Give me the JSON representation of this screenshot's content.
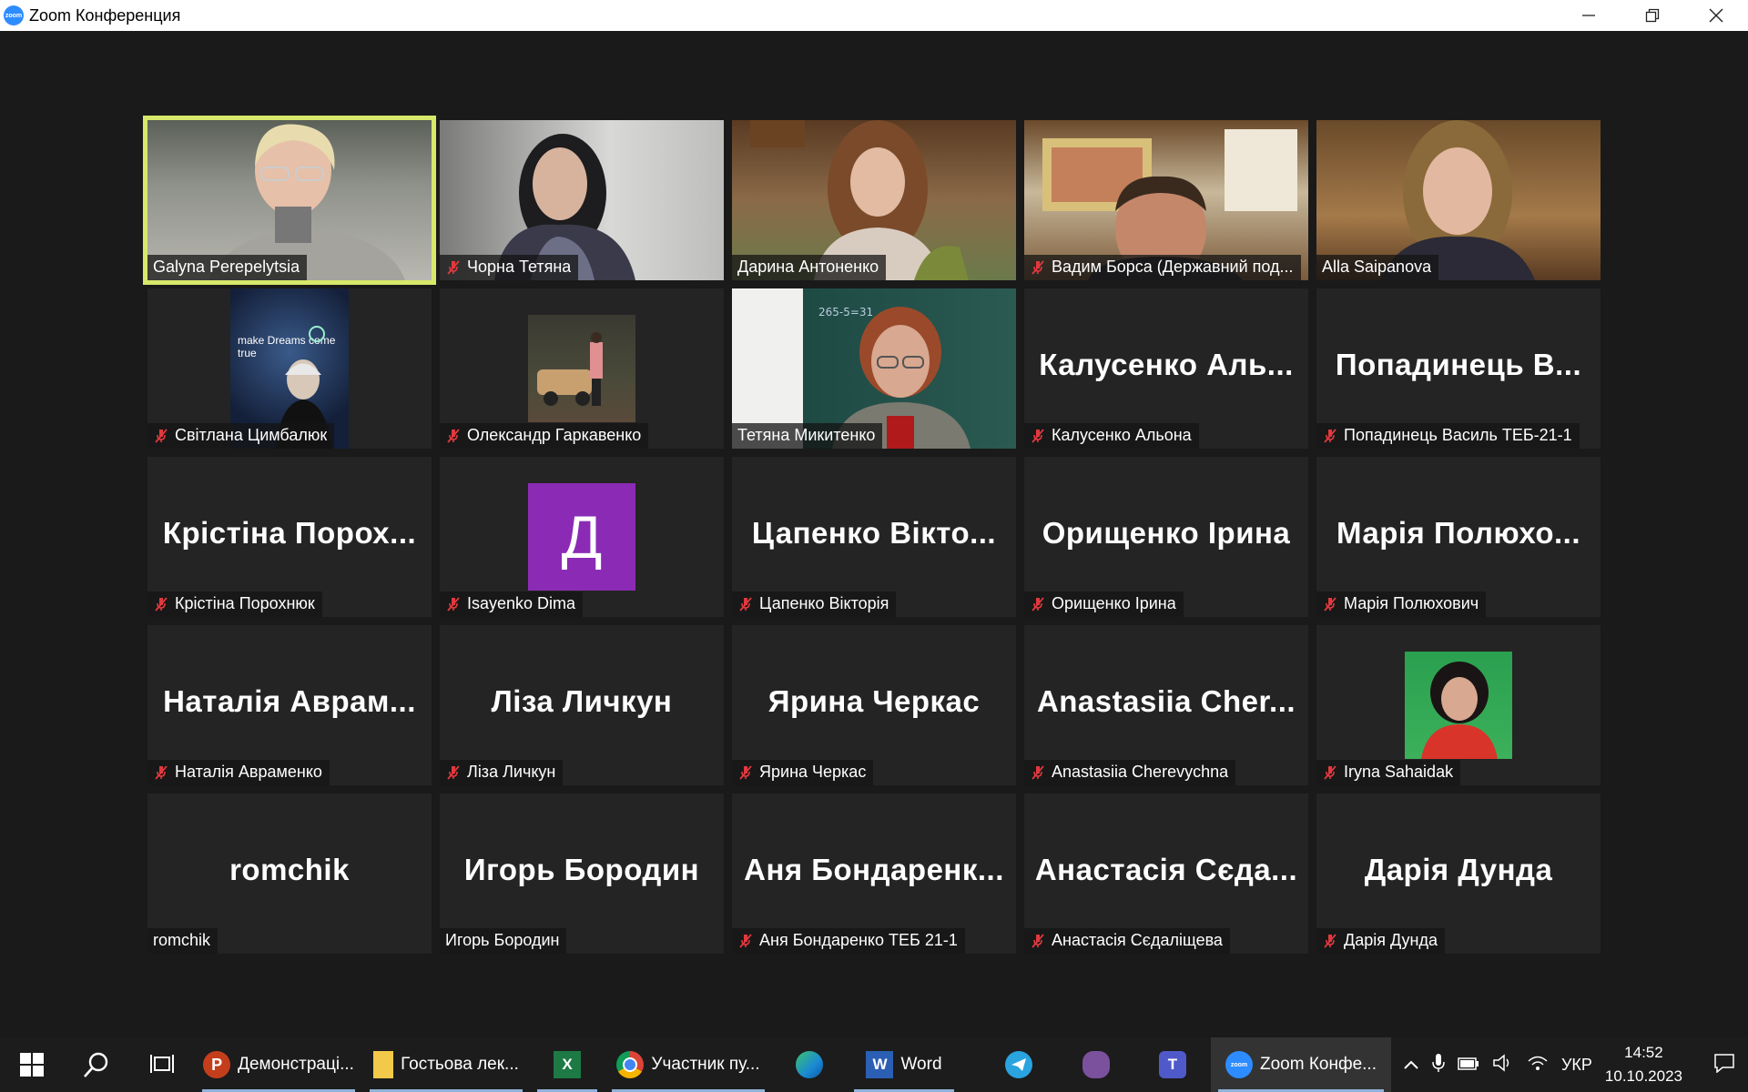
{
  "window": {
    "title": "Zoom Конференция",
    "logo_text": "zoom",
    "minimize": "—",
    "restore": "❐",
    "close": "✕"
  },
  "colors": {
    "active_speaker_border": "#d7e86b",
    "tile_bg": "#242424",
    "mute_red": "#e0393e",
    "avatar_purple": "#8b2bb5"
  },
  "participants": [
    {
      "name": "Galyna Perepelytsia",
      "muted": false,
      "video": true,
      "active": true
    },
    {
      "name": "Чорна Тетяна",
      "muted": true,
      "video": true
    },
    {
      "name": "Дарина Антоненко",
      "muted": false,
      "video": true
    },
    {
      "name": "Вадим Борса (Державний под...",
      "muted": true,
      "video": true
    },
    {
      "name": "Alla Saipanova",
      "muted": false,
      "video": true
    },
    {
      "name": "Світлана Цимбалюк",
      "muted": true,
      "picture": true,
      "picture_text": "make Dreams come true"
    },
    {
      "name": "Олександр Гаркавенко",
      "muted": true,
      "picture": true
    },
    {
      "name": "Тетяна Микитенко",
      "muted": false,
      "video": true
    },
    {
      "name": "Калусенко Альона",
      "muted": true,
      "display": "Калусенко Аль..."
    },
    {
      "name": "Попадинець Василь ТЕБ-21-1",
      "muted": true,
      "display": "Попадинець В..."
    },
    {
      "name": "Крістіна Порохнюк",
      "muted": true,
      "display": "Крістіна Порох..."
    },
    {
      "name": "Isayenko Dima",
      "muted": true,
      "avatar_letter": "Д"
    },
    {
      "name": "Цапенко Вікторія",
      "muted": true,
      "display": "Цапенко Вікто..."
    },
    {
      "name": "Орищенко Ірина",
      "muted": true,
      "display": "Орищенко Ірина"
    },
    {
      "name": "Марія Полюхович",
      "muted": true,
      "display": "Марія Полюхо..."
    },
    {
      "name": "Наталія Авраменко",
      "muted": true,
      "display": "Наталія Аврам..."
    },
    {
      "name": "Ліза Личкун",
      "muted": true,
      "display": "Ліза Личкун"
    },
    {
      "name": "Ярина Черкас",
      "muted": true,
      "display": "Ярина Черкас"
    },
    {
      "name": "Anastasiia Cherevychna",
      "muted": true,
      "display": "Anastasiia Cher..."
    },
    {
      "name": "Iryna Sahaidak",
      "muted": true,
      "picture": true
    },
    {
      "name": "romchik",
      "muted": false,
      "display": "romchik"
    },
    {
      "name": "Игорь Бородин",
      "muted": false,
      "display": "Игорь Бородин"
    },
    {
      "name": "Аня Бондаренко ТЕБ 21-1",
      "muted": true,
      "display": "Аня Бондаренк..."
    },
    {
      "name": "Анастасія Сєдаліщева",
      "muted": true,
      "display": "Анастасія Сєда..."
    },
    {
      "name": "Дарія Дунда",
      "muted": true,
      "display": "Дарія Дунда"
    }
  ],
  "taskbar": {
    "apps": [
      {
        "icon": "powerpoint-icon",
        "label": "Демонстраці..."
      },
      {
        "icon": "folder-icon",
        "label": "Гостьова лек..."
      },
      {
        "icon": "excel-icon",
        "label": ""
      },
      {
        "icon": "chrome-icon",
        "label": "Участник пу..."
      },
      {
        "icon": "edge-icon",
        "label": ""
      },
      {
        "icon": "word-icon",
        "label": "Word"
      },
      {
        "icon": "telegram-icon",
        "label": ""
      },
      {
        "icon": "viber-icon",
        "label": ""
      },
      {
        "icon": "teams-icon",
        "label": ""
      },
      {
        "icon": "zoom-icon",
        "label": "Zoom Конфе..."
      }
    ],
    "language": "УКР",
    "time": "14:52",
    "date": "10.10.2023"
  }
}
